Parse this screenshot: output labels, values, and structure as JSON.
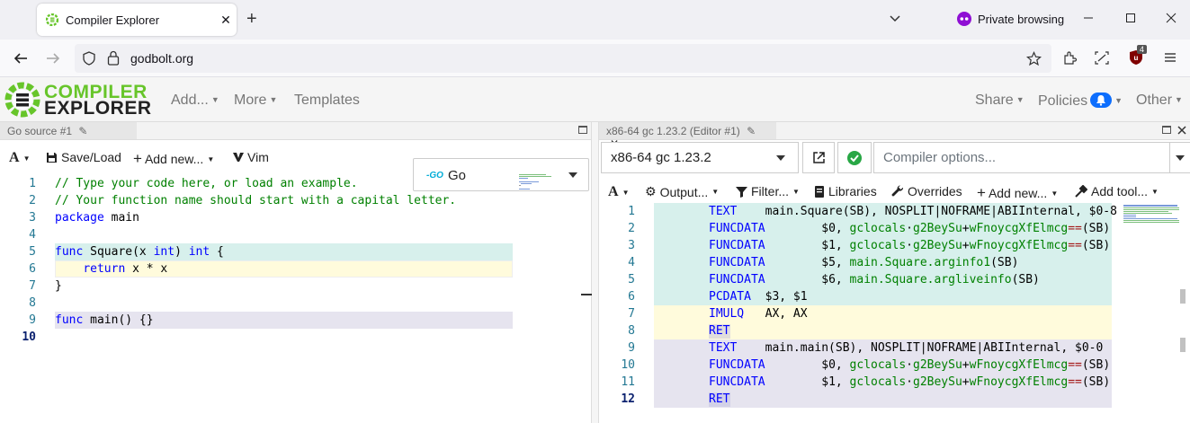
{
  "browser": {
    "tab_title": "Compiler Explorer",
    "private_label": "Private browsing",
    "url": "godbolt.org",
    "extension_badge": "4"
  },
  "header": {
    "logo_line1": "COMPILER",
    "logo_line2": "EXPLORER",
    "nav": [
      "Add...",
      "More",
      "Templates"
    ],
    "right_nav": [
      "Share",
      "Policies",
      "Other"
    ],
    "brand_color": "#67c52a"
  },
  "editor": {
    "tab_label": "Go source #1",
    "toolbar": {
      "font": "A",
      "save": "Save/Load",
      "add_new": "Add new...",
      "vim": "Vim"
    },
    "language": "Go",
    "line_numbers": [
      "1",
      "2",
      "3",
      "4",
      "5",
      "6",
      "7",
      "8",
      "9",
      "10"
    ],
    "lines": [
      [
        [
          "cm",
          "// Type your code here, or load an example."
        ]
      ],
      [
        [
          "cm",
          "// Your function name should start with a capital letter."
        ]
      ],
      [
        [
          "kw",
          "package"
        ],
        [
          "pl",
          " main"
        ]
      ],
      [],
      [
        [
          "kw",
          "func"
        ],
        [
          "pl",
          " Square(x "
        ],
        [
          "kw",
          "int"
        ],
        [
          "pl",
          ") "
        ],
        [
          "kw",
          "int"
        ],
        [
          "pl",
          " {"
        ]
      ],
      [
        [
          "pl",
          "    "
        ],
        [
          "kw",
          "return"
        ],
        [
          "pl",
          " x * x"
        ]
      ],
      [
        [
          "pl",
          "}"
        ]
      ],
      [],
      [
        [
          "kw",
          "func"
        ],
        [
          "pl",
          " main() {}"
        ]
      ],
      []
    ]
  },
  "compiler": {
    "tab_label": "x86-64 gc 1.23.2 (Editor #1)",
    "compiler_name": "x86-64 gc 1.23.2",
    "options_placeholder": "Compiler options...",
    "toolbar": {
      "font": "A",
      "output": "Output...",
      "filter": "Filter...",
      "libraries": "Libraries",
      "overrides": "Overrides",
      "add_new": "Add new...",
      "add_tool": "Add tool..."
    },
    "line_numbers": [
      "1",
      "2",
      "3",
      "4",
      "5",
      "6",
      "7",
      "8",
      "9",
      "10",
      "11",
      "12"
    ],
    "lines": [
      [
        [
          "asmkw",
          "TEXT"
        ],
        [
          "asmop",
          "    main.Square(SB), NOSPLIT|NOFRAME|ABIInternal, $0-8"
        ]
      ],
      [
        [
          "asmkw",
          "FUNCDATA"
        ],
        [
          "asmop",
          "        $0, "
        ],
        [
          "green",
          "gclocals"
        ],
        [
          "asmop",
          "·"
        ],
        [
          "green",
          "g2BeySu"
        ],
        [
          "asmop",
          "+"
        ],
        [
          "green",
          "wFnoycgXfElmcg"
        ],
        [
          "red",
          "=="
        ],
        [
          "asmop",
          "(SB)"
        ]
      ],
      [
        [
          "asmkw",
          "FUNCDATA"
        ],
        [
          "asmop",
          "        $1, "
        ],
        [
          "green",
          "gclocals"
        ],
        [
          "asmop",
          "·"
        ],
        [
          "green",
          "g2BeySu"
        ],
        [
          "asmop",
          "+"
        ],
        [
          "green",
          "wFnoycgXfElmcg"
        ],
        [
          "red",
          "=="
        ],
        [
          "asmop",
          "(SB)"
        ]
      ],
      [
        [
          "asmkw",
          "FUNCDATA"
        ],
        [
          "asmop",
          "        $5, "
        ],
        [
          "green",
          "main.Square.arginfo1"
        ],
        [
          "asmop",
          "(SB)"
        ]
      ],
      [
        [
          "asmkw",
          "FUNCDATA"
        ],
        [
          "asmop",
          "        $6, "
        ],
        [
          "green",
          "main.Square.argliveinfo"
        ],
        [
          "asmop",
          "(SB)"
        ]
      ],
      [
        [
          "asmkw",
          "PCDATA"
        ],
        [
          "asmop",
          "  $3, $1"
        ]
      ],
      [
        [
          "asmkw",
          "IMULQ"
        ],
        [
          "asmop",
          "   AX, AX"
        ]
      ],
      [
        [
          "asmkw",
          "RET"
        ]
      ],
      [
        [
          "asmkw",
          "TEXT"
        ],
        [
          "asmop",
          "    main.main(SB), NOSPLIT|NOFRAME|ABIInternal, $0-0"
        ]
      ],
      [
        [
          "asmkw",
          "FUNCDATA"
        ],
        [
          "asmop",
          "        $0, "
        ],
        [
          "green",
          "gclocals"
        ],
        [
          "asmop",
          "·"
        ],
        [
          "green",
          "g2BeySu"
        ],
        [
          "asmop",
          "+"
        ],
        [
          "green",
          "wFnoycgXfElmcg"
        ],
        [
          "red",
          "=="
        ],
        [
          "asmop",
          "(SB)"
        ]
      ],
      [
        [
          "asmkw",
          "FUNCDATA"
        ],
        [
          "asmop",
          "        $1, "
        ],
        [
          "green",
          "gclocals"
        ],
        [
          "asmop",
          "·"
        ],
        [
          "green",
          "g2BeySu"
        ],
        [
          "asmop",
          "+"
        ],
        [
          "green",
          "wFnoycgXfElmcg"
        ],
        [
          "red",
          "=="
        ],
        [
          "asmop",
          "(SB)"
        ]
      ],
      [
        [
          "asmkw",
          "RET"
        ]
      ]
    ],
    "line_highlight_colors": [
      "#d7f0ec",
      "#d7f0ec",
      "#d7f0ec",
      "#d7f0ec",
      "#d7f0ec",
      "#d7f0ec",
      "#fffbdc",
      "#fffbdc",
      "#e6e4ef",
      "#e6e4ef",
      "#e6e4ef",
      "#e6e4ef"
    ]
  },
  "editor_line_highlight_colors": [
    "",
    "",
    "",
    "",
    "#d7f0ec",
    "#fffbdc",
    "",
    "",
    "#e6e4ef",
    ""
  ]
}
